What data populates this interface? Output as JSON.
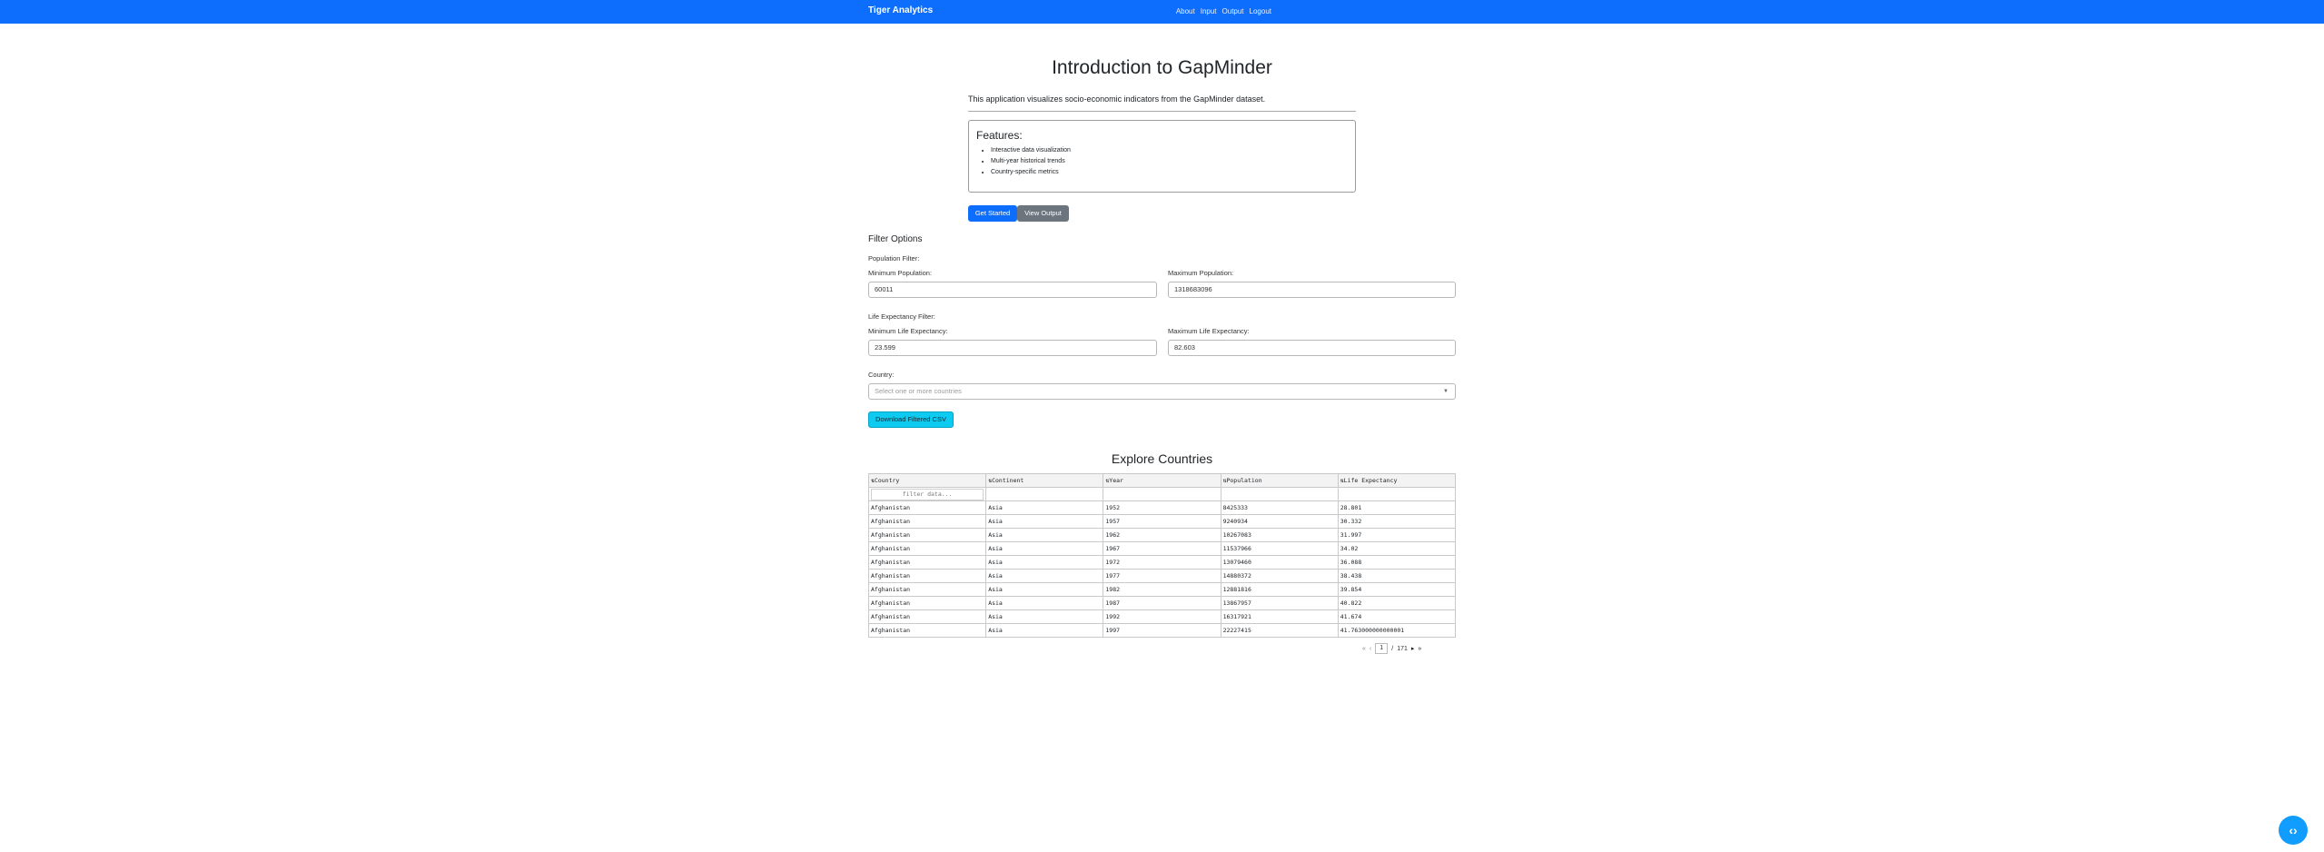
{
  "navbar": {
    "brand": "Tiger Analytics",
    "links": [
      "About",
      "Input",
      "Output",
      "Logout"
    ]
  },
  "hero": {
    "title": "Introduction to GapMinder",
    "intro": "This application visualizes socio-economic indicators from the GapMinder dataset.",
    "features_title": "Features:",
    "features": [
      "Interactive data visualization",
      "Multi-year historical trends",
      "Country-specific metrics"
    ],
    "get_started_label": "Get Started",
    "view_output_label": "View Output"
  },
  "filters": {
    "heading": "Filter Options",
    "population_filter_label": "Population Filter:",
    "min_population_label": "Minimum Population:",
    "min_population_value": "60011",
    "max_population_label": "Maximum Population:",
    "max_population_value": "1318683096",
    "life_filter_label": "Life Expectancy Filter:",
    "min_life_label": "Minimum Life Expectancy:",
    "min_life_value": "23.599",
    "max_life_label": "Maximum Life Expectancy:",
    "max_life_value": "82.603",
    "country_label": "Country:",
    "country_placeholder": "Select one or more countries",
    "download_label": "Download Filtered CSV"
  },
  "table": {
    "heading": "Explore Countries",
    "columns": [
      "⇅Country",
      "⇅Continent",
      "⇅Year",
      "⇅Population",
      "⇅Life Expectancy"
    ],
    "filter_placeholder": "filter data...",
    "rows": [
      [
        "Afghanistan",
        "Asia",
        "1952",
        "8425333",
        "28.801"
      ],
      [
        "Afghanistan",
        "Asia",
        "1957",
        "9240934",
        "30.332"
      ],
      [
        "Afghanistan",
        "Asia",
        "1962",
        "10267083",
        "31.997"
      ],
      [
        "Afghanistan",
        "Asia",
        "1967",
        "11537966",
        "34.02"
      ],
      [
        "Afghanistan",
        "Asia",
        "1972",
        "13079460",
        "36.088"
      ],
      [
        "Afghanistan",
        "Asia",
        "1977",
        "14880372",
        "38.438"
      ],
      [
        "Afghanistan",
        "Asia",
        "1982",
        "12881816",
        "39.854"
      ],
      [
        "Afghanistan",
        "Asia",
        "1987",
        "13867957",
        "40.822"
      ],
      [
        "Afghanistan",
        "Asia",
        "1992",
        "16317921",
        "41.674"
      ],
      [
        "Afghanistan",
        "Asia",
        "1997",
        "22227415",
        "41.763000000000001"
      ]
    ],
    "pager": {
      "current_page": "1",
      "separator": "/",
      "total_pages": "171"
    }
  },
  "icons": {
    "first": "first-page-icon",
    "prev": "prev-page-icon",
    "next": "next-page-icon",
    "last": "last-page-icon",
    "fab": "code-brackets-icon"
  },
  "colors": {
    "primary": "#0d6efd",
    "secondary": "#6c757d",
    "info": "#0dcaf0",
    "fab": "#119dff"
  }
}
